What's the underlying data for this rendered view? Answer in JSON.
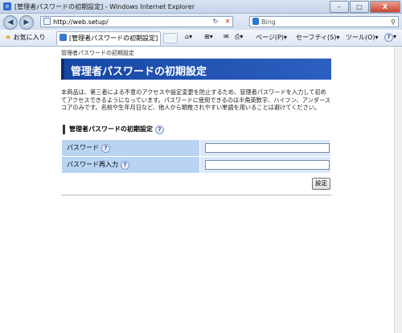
{
  "window": {
    "title": "[管理者パスワードの初期設定] - Windows Internet Explorer",
    "minimize": "–",
    "maximize": "□",
    "close": "X"
  },
  "address_bar": {
    "url": "http://web.setup/",
    "search_placeholder": "Bing",
    "back_icon": "back-arrow-icon",
    "forward_icon": "forward-arrow-icon"
  },
  "favorites_bar": {
    "favorites_label": "お気に入り",
    "tab_title": "[管理者パスワードの初期設定]",
    "commands": {
      "page": "ページ(P)",
      "safety": "セーフティ(S)",
      "tools": "ツール(O)",
      "help": "?"
    }
  },
  "page": {
    "breadcrumb": "管理者パスワードの初期設定",
    "heading": "管理者パスワードの初期設定",
    "description": "本商品は、第三者による不意のアクセスや設定変更を防止するため、管理者パスワードを入力して初めてアクセスできるようになっています。パスワードに使用できるのは半角英数字、ハイフン、アンダースコアのみです。名前や生年月日など、他人から類推されやすい単語を用いることは避けてください。",
    "section_title": "管理者パスワードの初期設定",
    "fields": [
      {
        "label": "パスワード",
        "value": ""
      },
      {
        "label": "パスワード再入力",
        "value": ""
      }
    ],
    "submit_label": "設定",
    "help_glyph": "?"
  }
}
